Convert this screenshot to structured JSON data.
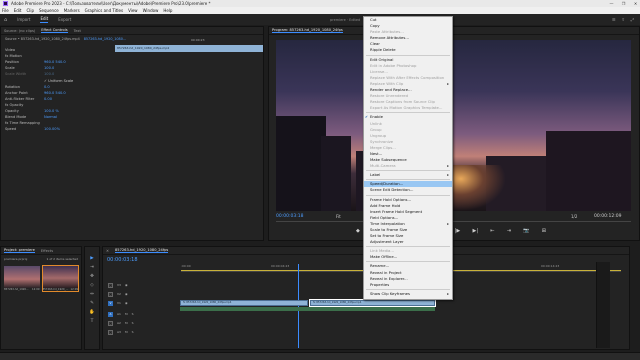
{
  "window": {
    "title": "Adobe Premiere Pro 2023 - C:\\Пользователи\\User\\Документы\\Adobe\\Premiere Pro\\23.0\\premiere *",
    "controls": [
      "—",
      "❐",
      "✕"
    ]
  },
  "menubar": [
    "File",
    "Edit",
    "Clip",
    "Sequence",
    "Markers",
    "Graphics and Titles",
    "View",
    "Window",
    "Help"
  ],
  "header": {
    "tabs": [
      "Import",
      "Edit",
      "Export"
    ],
    "active_tab": "Edit",
    "center_text": "premiere  · Edited"
  },
  "effect_controls": {
    "tabs": [
      "Source: (no clips)",
      "Effect Controls",
      "Text"
    ],
    "source_label": "Source • 857263-hd_1920_1080_24fps.mp4",
    "seq_label": "857263-hd_1920_1080...",
    "clip_name": "857263-hd_1920_1080_24fps.mp4",
    "time_left": "00:00:23",
    "rows": [
      {
        "label": "Video",
        "value": "",
        "kind": "section"
      },
      {
        "label": "fx  Motion",
        "value": "",
        "kind": "fx"
      },
      {
        "label": "Position",
        "value": "960.0   540.0",
        "kind": "prop"
      },
      {
        "label": "Scale",
        "value": "100.0",
        "kind": "prop"
      },
      {
        "label": "Scale Width",
        "value": "100.0",
        "kind": "dim"
      },
      {
        "label": "",
        "value": "✓ Uniform Scale",
        "kind": "check"
      },
      {
        "label": "Rotation",
        "value": "0.0",
        "kind": "prop"
      },
      {
        "label": "Anchor Point",
        "value": "960.0   540.0",
        "kind": "prop"
      },
      {
        "label": "Anti-flicker Filter",
        "value": "0.00",
        "kind": "prop"
      },
      {
        "label": "fx  Opacity",
        "value": "",
        "kind": "fx"
      },
      {
        "label": "Opacity",
        "value": "100.0 %",
        "kind": "prop"
      },
      {
        "label": "Blend Mode",
        "value": "Normal",
        "kind": "prop"
      },
      {
        "label": "fx  Time Remapping",
        "value": "",
        "kind": "fx"
      },
      {
        "label": "Speed",
        "value": "100.00%",
        "kind": "prop"
      }
    ]
  },
  "program": {
    "tab_label": "Program: 857263-hd_1920_1080_24fps",
    "timecode_current": "00:00:03:18",
    "timecode_end": "00:00:12:09",
    "fit": "Fit",
    "quality": "1/2",
    "buttons": [
      "◆",
      "{",
      "}",
      "|◀",
      "◀|",
      "▶",
      "|▶",
      "▶|",
      "⇤",
      "⇥",
      "📷",
      "⊞"
    ]
  },
  "context_menu": {
    "items": [
      {
        "label": "Cut",
        "state": "normal"
      },
      {
        "label": "Copy",
        "state": "normal"
      },
      {
        "label": "Paste Attributes...",
        "state": "disabled"
      },
      {
        "label": "Remove Attributes...",
        "state": "normal"
      },
      {
        "label": "Clear",
        "state": "normal"
      },
      {
        "label": "Ripple Delete",
        "state": "normal"
      },
      {
        "sep": true
      },
      {
        "label": "Edit Original",
        "state": "normal"
      },
      {
        "label": "Edit in Adobe Photoshop",
        "state": "disabled"
      },
      {
        "label": "License...",
        "state": "disabled"
      },
      {
        "label": "Replace With After Effects Composition",
        "state": "disabled"
      },
      {
        "label": "Replace With Clip",
        "state": "disabled",
        "submenu": true
      },
      {
        "label": "Render and Replace...",
        "state": "normal"
      },
      {
        "label": "Restore Unrendered",
        "state": "disabled"
      },
      {
        "label": "Restore Captions from Source Clip",
        "state": "disabled"
      },
      {
        "label": "Export As Motion Graphics Template...",
        "state": "disabled"
      },
      {
        "sep": true
      },
      {
        "label": "Enable",
        "state": "checked"
      },
      {
        "label": "Unlink",
        "state": "disabled"
      },
      {
        "label": "Group",
        "state": "disabled"
      },
      {
        "label": "Ungroup",
        "state": "disabled"
      },
      {
        "label": "Synchronize",
        "state": "disabled"
      },
      {
        "label": "Merge Clips...",
        "state": "disabled"
      },
      {
        "label": "Nest...",
        "state": "normal"
      },
      {
        "label": "Make Subsequence",
        "state": "normal"
      },
      {
        "label": "Multi-Camera",
        "state": "disabled",
        "submenu": true
      },
      {
        "sep": true
      },
      {
        "label": "Label",
        "state": "normal",
        "submenu": true
      },
      {
        "sep": true
      },
      {
        "label": "Speed/Duration...",
        "state": "highlight"
      },
      {
        "label": "Scene Edit Detection...",
        "state": "normal"
      },
      {
        "sep": true
      },
      {
        "label": "Frame Hold Options...",
        "state": "normal"
      },
      {
        "label": "Add Frame Hold",
        "state": "normal"
      },
      {
        "label": "Insert Frame Hold Segment",
        "state": "normal"
      },
      {
        "label": "Field Options...",
        "state": "normal"
      },
      {
        "label": "Time Interpolation",
        "state": "normal",
        "submenu": true
      },
      {
        "label": "Scale to Frame Size",
        "state": "normal"
      },
      {
        "label": "Set to Frame Size",
        "state": "normal"
      },
      {
        "label": "Adjustment Layer",
        "state": "normal"
      },
      {
        "sep": true
      },
      {
        "label": "Link Media...",
        "state": "disabled"
      },
      {
        "label": "Make Offline...",
        "state": "normal"
      },
      {
        "sep": true
      },
      {
        "label": "Rename...",
        "state": "normal"
      },
      {
        "label": "Reveal in Project",
        "state": "normal"
      },
      {
        "label": "Reveal in Explorer...",
        "state": "normal"
      },
      {
        "label": "Properties",
        "state": "normal"
      },
      {
        "sep": true
      },
      {
        "label": "Show Clip Keyframes",
        "state": "normal",
        "submenu": true
      }
    ]
  },
  "project": {
    "tabs": [
      "Project: premiere",
      "Effects"
    ],
    "name": "premiere.prproj",
    "item_count": "1 of 2 items selected",
    "thumbs": [
      {
        "name": "857263-hd_1920...",
        "dur": "12:09"
      },
      {
        "name": "857263-hd_1920_...",
        "dur": "12:09"
      }
    ]
  },
  "timeline": {
    "tab_label": "857263-hd_1920_1080_24fps",
    "timecode": "00:00:03:18",
    "ruler": [
      ":00:00",
      "00:00:04:23",
      "00:00:09:23",
      "00:00:14:23"
    ],
    "tracks_v": [
      "V3",
      "V2",
      "V1"
    ],
    "tracks_a": [
      "A1",
      "A2",
      "A3"
    ],
    "clips": [
      {
        "track": "V1",
        "label": "fx 857263-hd_1920_1080_24fps.mp4"
      },
      {
        "track": "V1",
        "label": "fx 857263-hd_1920_1080_24fps.mp4"
      }
    ]
  },
  "tools": [
    "▶",
    "⇥",
    "✥",
    "◇",
    "⇔",
    "✎",
    "✋",
    "T"
  ],
  "colors": {
    "accent": "#3b8cff",
    "clip": "#8fb3d6",
    "highlight": "#99c7f3"
  }
}
